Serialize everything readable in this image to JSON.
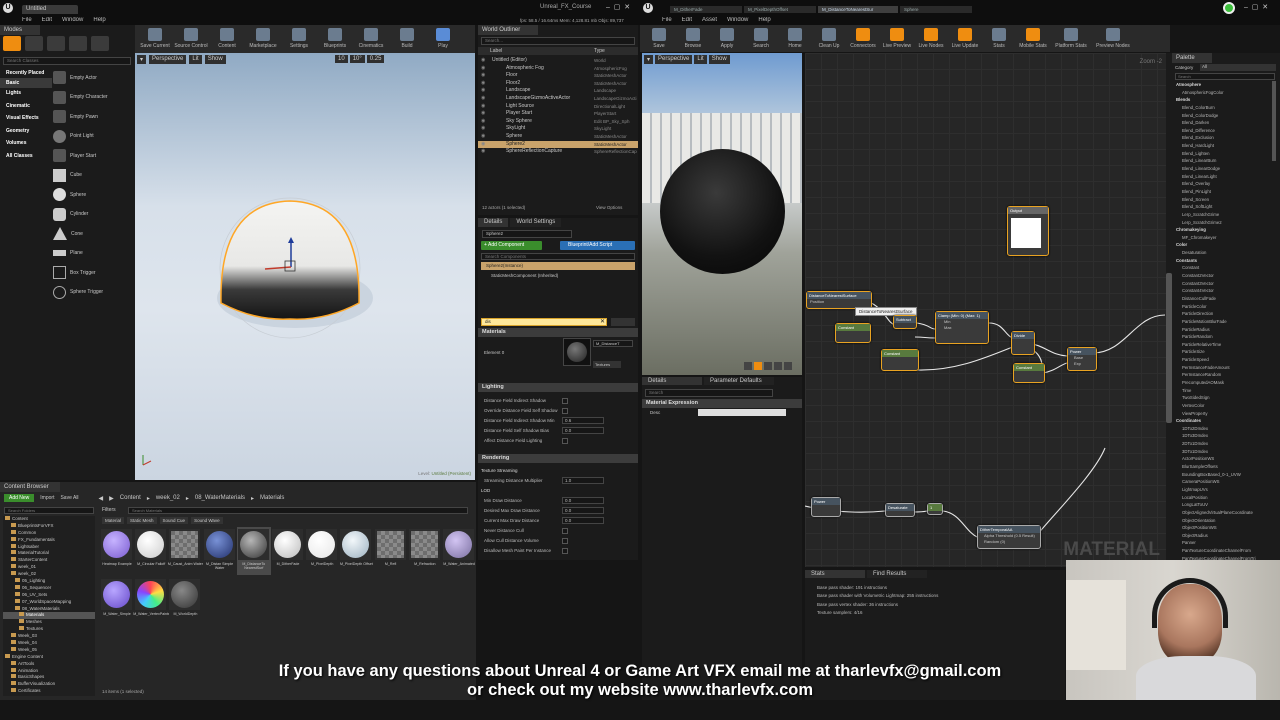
{
  "left_editor": {
    "tab": "Untitled",
    "menu": [
      "File",
      "Edit",
      "Window",
      "Help"
    ],
    "project": "Unreal_FX_Course",
    "stats": "fps: 58.5 / 16.64ms   Mem: 4,128.81 mb   Objs: 89,737",
    "modes_label": "Modes",
    "search_placeholder": "Search Classes",
    "categories": [
      "Recently Placed",
      "Basic",
      "Lights",
      "Cinematic",
      "Visual Effects",
      "Geometry",
      "Volumes",
      "All Classes"
    ],
    "actors": [
      "Empty Actor",
      "Empty Character",
      "Empty Pawn",
      "Point Light",
      "Player Start",
      "Cube",
      "Sphere",
      "Cylinder",
      "Cone",
      "Plane",
      "Box Trigger",
      "Sphere Trigger"
    ],
    "toolbar": [
      "Save Current",
      "Source Control",
      "Content",
      "Marketplace",
      "Settings",
      "Blueprints",
      "Cinematics",
      "Build",
      "Play"
    ],
    "viewport": {
      "perspective": "Perspective",
      "lit": "Lit",
      "show": "Show",
      "snap": "10",
      "rot": "10°",
      "scale": "0.25",
      "level": "Level:",
      "level_name": "Untitled (Persistent)"
    },
    "outliner": {
      "tab": "World Outliner",
      "search_placeholder": "Search...",
      "col_label": "Label",
      "col_type": "Type",
      "items": [
        {
          "label": "Untitled (Editor)",
          "type": "World"
        },
        {
          "label": "Atmospheric Fog",
          "type": "AtmosphericFog"
        },
        {
          "label": "Floor",
          "type": "StaticMeshActor"
        },
        {
          "label": "Floor2",
          "type": "StaticMeshActor"
        },
        {
          "label": "Landscape",
          "type": "Landscape"
        },
        {
          "label": "LandscapeGizmoActiveActor",
          "type": "LandscapeGizmoActi"
        },
        {
          "label": "Light Source",
          "type": "DirectionalLight"
        },
        {
          "label": "Player Start",
          "type": "PlayerStart"
        },
        {
          "label": "Sky Sphere",
          "type": "Edit BP_Sky_Sph"
        },
        {
          "label": "SkyLight",
          "type": "SkyLight"
        },
        {
          "label": "Sphere",
          "type": "StaticMeshActor"
        },
        {
          "label": "Sphere2",
          "type": "StaticMeshActor"
        },
        {
          "label": "SphereReflectionCapture",
          "type": "SphereReflectionCap"
        }
      ],
      "footer": "12 actors (1 selected)",
      "view_options": "View Options"
    },
    "details": {
      "tab": "Details",
      "tab2": "World Settings",
      "name": "Sphere2",
      "add_component": "+ Add Component",
      "blueprint": "Blueprint/Add Script",
      "search_components": "Search Components",
      "comp_root": "Sphere2(Instance)",
      "comp_child": "StaticMeshComponent (Inherited)",
      "search_value": "dis",
      "materials_title": "Materials",
      "element": "Element 0",
      "material_name": "M_DistanceT",
      "textures": "Textures",
      "lighting_title": "Lighting",
      "lighting_rows": [
        "Distance Field Indirect Shadow",
        "Override Distance Field Self Shadow",
        "Distance Field Indirect Shadow Min",
        "Distance Field Self Shadow Bias",
        "Affect Distance Field Lighting"
      ],
      "lighting_values": [
        "",
        "",
        "0.6",
        "0.0",
        ""
      ],
      "rendering_title": "Rendering",
      "rendering_rows": [
        "Texture Streaming",
        "Streaming Distance Multiplier",
        "LOD",
        "Min Draw Distance",
        "Desired Max Draw Distance",
        "Current Max Draw Distance",
        "Never Distance Cull",
        "Allow Cull Distance Volume",
        "Disallow Mesh Paint Per Instance"
      ],
      "rendering_values": [
        "",
        "1.0",
        "",
        "0.0",
        "0.0",
        "0.0",
        "",
        "",
        ""
      ]
    },
    "content_browser": {
      "tab": "Content Browser",
      "add_new": "Add New",
      "import": "Import",
      "save_all": "Save All",
      "path": [
        "Content",
        "week_02",
        "08_WaterMaterials",
        "Materials"
      ],
      "filters": "Filters",
      "search_placeholder": "Search Materials",
      "tabs": [
        "Material",
        "Static Mesh",
        "Sound Cue",
        "Sound Wave"
      ],
      "search_folders": "Search Folders",
      "folders": [
        "Content",
        "BlueprintsForVFX",
        "Common",
        "FX_Fundamentals",
        "Lightsaber",
        "MaterialTutorial",
        "StarterContent",
        "week_01",
        "week_02",
        "05_Lighting",
        "06_Sequencer",
        "06_UV_Sets",
        "07_WorldSpaceMapping",
        "08_WaterMaterials",
        "Materials",
        "Meshes",
        "Textures",
        "Week_03",
        "Week_04",
        "Week_05",
        "Engine Content",
        "ArtTools",
        "Animation",
        "BasicShapes",
        "BufferVisualization",
        "Certificates"
      ],
      "assets": [
        "Heatmap Example",
        "M_Circular Falloff",
        "M_Caust_Anim Water",
        "M_Distan Simple Water",
        "M_DistanceTo NearestSurf",
        "M_DitherFade",
        "M_PixelDepth",
        "M_PixelDepth Offset",
        "M_Refl",
        "M_Refraction",
        "M_Water_Animated",
        "M_Water_Simple",
        "M_Water_VertexPainted",
        "M_WorldDepth"
      ],
      "count": "14 items (1 selected)"
    }
  },
  "right_editor": {
    "tabs": [
      "M_DitherFade",
      "M_PixelDepthOffset",
      "M_DistanceToNearestSur",
      "Sphere"
    ],
    "menu": [
      "File",
      "Edit",
      "Asset",
      "Window",
      "Help"
    ],
    "toolbar": [
      "Save",
      "Browse",
      "Apply",
      "Search",
      "Home",
      "Clean Up",
      "Connectors",
      "Live Preview",
      "Live Nodes",
      "Live Update",
      "Stats",
      "Mobile Stats",
      "Platform Stats",
      "Preview Nodes"
    ],
    "preview": {
      "perspective": "Perspective",
      "lit": "Lit",
      "show": "Show"
    },
    "details_tab": "Details",
    "param_tab": "Parameter Defaults",
    "search": "Search",
    "param_section": "Material Expression",
    "param_label": "Desc",
    "graph": {
      "zoom": "Zoom -2",
      "watermark": "MATERIAL",
      "tooltip": "DistanceToNearestSurface",
      "nodes": [
        "DistanceToNearestSurface",
        "Subtract",
        "Clamp (Min: 0) (Max: 1)",
        "Divide",
        "Power",
        "Constant",
        "Constant",
        "Desaturation",
        "Desaturate",
        "Constant",
        "Power",
        "Output",
        "DitherTemporalAA"
      ],
      "pins": [
        "Position",
        "Min",
        "Max",
        "Base",
        "Exp",
        "Alpha Threshold (0.5 Result)",
        "Random (0)"
      ]
    },
    "stats": {
      "tab": "Stats",
      "tab2": "Find Results",
      "lines": [
        "Base pass shader: 191 instructions",
        "Base pass shader with Volumetric Lightmap: 255 instructions",
        "Base pass vertex shader: 36 instructions",
        "Texture samplers: 4/16"
      ]
    },
    "palette": {
      "tab": "Palette",
      "category": "Category",
      "all": "All",
      "search_placeholder": "Search",
      "items": [
        "Atmosphere",
        "AtmosphericFogColor",
        "Blends",
        "Blend_ColorBurn",
        "Blend_ColorDodge",
        "Blend_Darken",
        "Blend_Difference",
        "Blend_Exclusion",
        "Blend_HardLight",
        "Blend_Lighten",
        "Blend_LinearBurn",
        "Blend_LinearDodge",
        "Blend_LinearLight",
        "Blend_Overlay",
        "Blend_PinLight",
        "Blend_Screen",
        "Blend_SoftLight",
        "Lerp_ScratchGrime",
        "Lerp_ScratchGrime2",
        "Chromakeying",
        "MF_Chromakeyer",
        "Color",
        "Desaturation",
        "Constants",
        "Constant",
        "Constant2Vector",
        "Constant3Vector",
        "Constant4Vector",
        "DistanceCullFade",
        "ParticleColor",
        "ParticleDirection",
        "ParticleMotionBlurFade",
        "ParticleRadius",
        "ParticleRandom",
        "ParticleRelativeTime",
        "ParticleSize",
        "ParticleSpeed",
        "PerInstanceFadeAmount",
        "PerInstanceRandom",
        "PrecomputedAOMask",
        "Time",
        "TwoSidedSign",
        "VertexColor",
        "ViewProperty",
        "Coordinates",
        "1DTo2DIndex",
        "1DTo3DIndex",
        "2DTo1DIndex",
        "3DTo1DIndex",
        "ActorPositionWS",
        "BlurSampleOffsets",
        "BoundingBoxBased_0-1_UVW",
        "CameraPositionWS",
        "LightmapUVs",
        "LocalPosition",
        "LongLatToUV",
        "ObjectAlignedVirtualPlaneCoordinate",
        "ObjectOrientation",
        "ObjectPositionWS",
        "ObjectRadius",
        "Panner",
        "PanTextureCoordinateChannelFrom",
        "PanTextureCoordinateChannelFromTri"
      ],
      "headers": [
        "Atmosphere",
        "Blends",
        "Chromakeying",
        "Color",
        "Constants",
        "Coordinates"
      ]
    }
  },
  "caption": {
    "line1": "If you have any questions about Unreal 4 or Game Art VFX email me at tharlevfx@gmail.com",
    "line2": "or check out my website www.tharlevfx.com"
  },
  "colors": {
    "accent": "#ef8d10",
    "selection": "#ffa726",
    "node_border": "#e9a322",
    "add_button": "#3a8d2c"
  }
}
